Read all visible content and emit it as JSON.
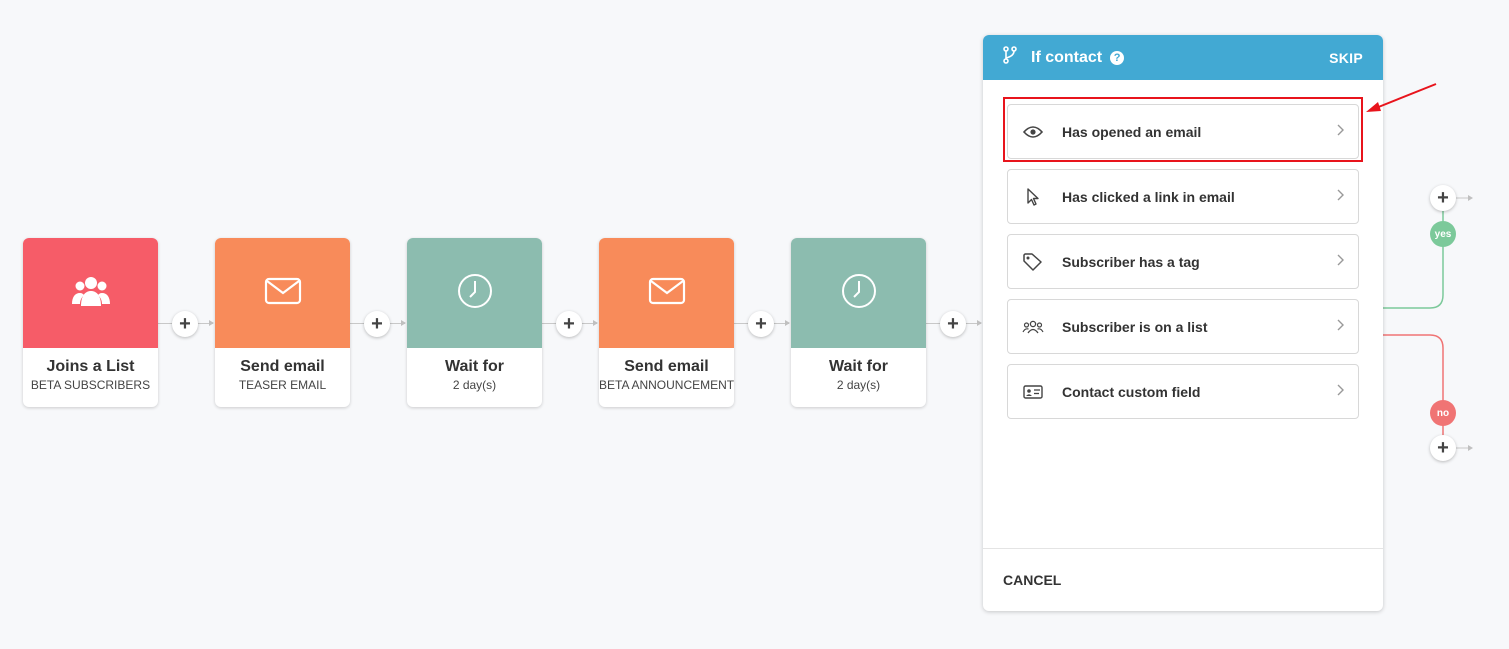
{
  "workflow": {
    "steps": [
      {
        "title": "Joins a List",
        "subtitle": "BETA SUBSCRIBERS",
        "icon": "users-icon",
        "color": "#f65c68"
      },
      {
        "title": "Send email",
        "subtitle": "TEASER EMAIL",
        "icon": "envelope-icon",
        "color": "#f88b5a"
      },
      {
        "title": "Wait for",
        "subtitle": "2 day(s)",
        "icon": "clock-icon",
        "color": "#8cbcaf"
      },
      {
        "title": "Send email",
        "subtitle": "BETA ANNOUNCEMENT",
        "icon": "envelope-icon",
        "color": "#f88b5a"
      },
      {
        "title": "Wait for",
        "subtitle": "2 day(s)",
        "icon": "clock-icon",
        "color": "#8cbcaf"
      }
    ],
    "add_symbol": "+"
  },
  "panel": {
    "title": "If contact",
    "help_symbol": "?",
    "skip_label": "SKIP",
    "header_color": "#42a9d3",
    "options": [
      {
        "label": "Has opened an email",
        "icon": "eye-icon"
      },
      {
        "label": "Has clicked a link in email",
        "icon": "cursor-icon"
      },
      {
        "label": "Subscriber has a tag",
        "icon": "tag-icon"
      },
      {
        "label": "Subscriber is on a list",
        "icon": "users-icon"
      },
      {
        "label": "Contact custom field",
        "icon": "id-card-icon"
      }
    ],
    "cancel_label": "CANCEL"
  },
  "branches": {
    "yes_label": "yes",
    "no_label": "no",
    "yes_color": "#7cc99a",
    "no_color": "#f07474"
  },
  "annotation": {
    "highlight_color": "#e8141c"
  }
}
